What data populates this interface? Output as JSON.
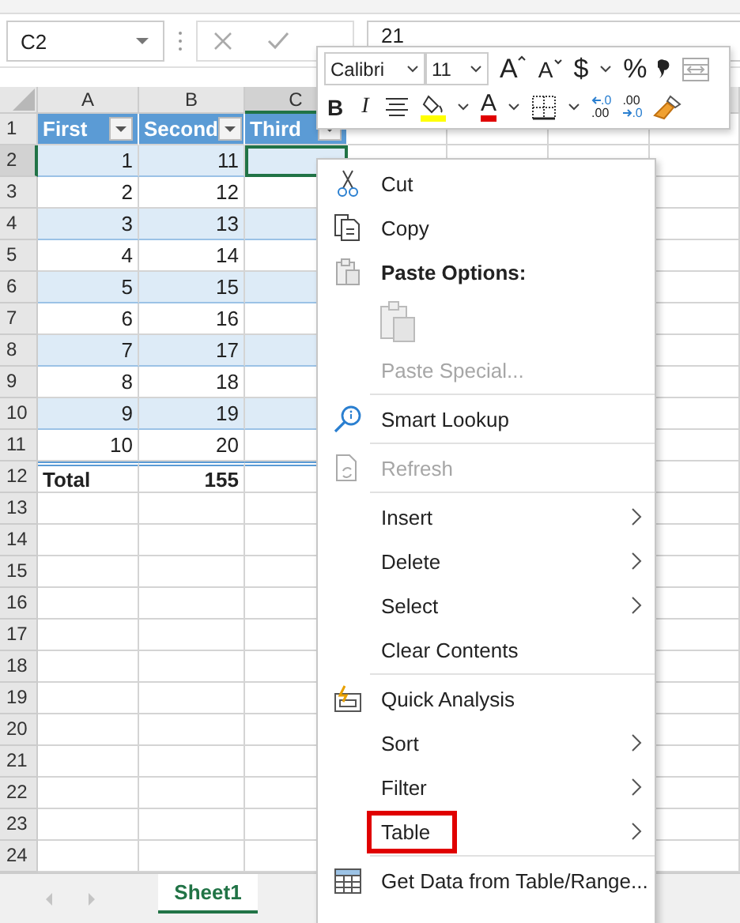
{
  "formula_bar": {
    "name_box": "C2",
    "formula": "21"
  },
  "mini_toolbar": {
    "font": "Calibri",
    "size": "11",
    "grow_font": "A",
    "shrink_font": "A",
    "currency": "$",
    "percent": "%",
    "bold": "B",
    "italic": "I",
    "font_color": "A",
    "increase_decimal": {
      "top": ".0",
      "bottom": ".00"
    },
    "decrease_decimal": {
      "top": ".00",
      "bottom": ".0"
    }
  },
  "grid": {
    "columns": [
      {
        "label": "A",
        "selected": false
      },
      {
        "label": "B",
        "selected": false
      },
      {
        "label": "C",
        "selected": true
      }
    ],
    "rows": [
      {
        "number": "1",
        "selected": false,
        "kind": "header",
        "cells": [
          "First",
          "Second",
          "Third"
        ]
      },
      {
        "number": "2",
        "selected": true,
        "kind": "data",
        "cells": [
          "1",
          "11",
          ""
        ]
      },
      {
        "number": "3",
        "selected": false,
        "kind": "data",
        "cells": [
          "2",
          "12",
          ""
        ]
      },
      {
        "number": "4",
        "selected": false,
        "kind": "data",
        "cells": [
          "3",
          "13",
          ""
        ]
      },
      {
        "number": "5",
        "selected": false,
        "kind": "data",
        "cells": [
          "4",
          "14",
          ""
        ]
      },
      {
        "number": "6",
        "selected": false,
        "kind": "data",
        "cells": [
          "5",
          "15",
          ""
        ]
      },
      {
        "number": "7",
        "selected": false,
        "kind": "data",
        "cells": [
          "6",
          "16",
          ""
        ]
      },
      {
        "number": "8",
        "selected": false,
        "kind": "data",
        "cells": [
          "7",
          "17",
          ""
        ]
      },
      {
        "number": "9",
        "selected": false,
        "kind": "data",
        "cells": [
          "8",
          "18",
          ""
        ]
      },
      {
        "number": "10",
        "selected": false,
        "kind": "data",
        "cells": [
          "9",
          "19",
          ""
        ]
      },
      {
        "number": "11",
        "selected": false,
        "kind": "data",
        "cells": [
          "10",
          "20",
          ""
        ]
      },
      {
        "number": "12",
        "selected": false,
        "kind": "total",
        "cells": [
          "Total",
          "155",
          ""
        ]
      },
      {
        "number": "13",
        "selected": false,
        "kind": "empty",
        "cells": [
          "",
          "",
          ""
        ]
      },
      {
        "number": "14",
        "selected": false,
        "kind": "empty",
        "cells": [
          "",
          "",
          ""
        ]
      },
      {
        "number": "15",
        "selected": false,
        "kind": "empty",
        "cells": [
          "",
          "",
          ""
        ]
      },
      {
        "number": "16",
        "selected": false,
        "kind": "empty",
        "cells": [
          "",
          "",
          ""
        ]
      },
      {
        "number": "17",
        "selected": false,
        "kind": "empty",
        "cells": [
          "",
          "",
          ""
        ]
      },
      {
        "number": "18",
        "selected": false,
        "kind": "empty",
        "cells": [
          "",
          "",
          ""
        ]
      },
      {
        "number": "19",
        "selected": false,
        "kind": "empty",
        "cells": [
          "",
          "",
          ""
        ]
      },
      {
        "number": "20",
        "selected": false,
        "kind": "empty",
        "cells": [
          "",
          "",
          ""
        ]
      },
      {
        "number": "21",
        "selected": false,
        "kind": "empty",
        "cells": [
          "",
          "",
          ""
        ]
      },
      {
        "number": "22",
        "selected": false,
        "kind": "empty",
        "cells": [
          "",
          "",
          ""
        ]
      },
      {
        "number": "23",
        "selected": false,
        "kind": "empty",
        "cells": [
          "",
          "",
          ""
        ]
      },
      {
        "number": "24",
        "selected": false,
        "kind": "empty",
        "cells": [
          "",
          "",
          ""
        ]
      }
    ]
  },
  "context_menu": {
    "items": [
      {
        "kind": "item",
        "label": "Cut",
        "disabled": false,
        "submenu": false,
        "highlighted": false
      },
      {
        "kind": "item",
        "label": "Copy",
        "disabled": false,
        "submenu": false,
        "highlighted": false
      },
      {
        "kind": "heading",
        "label": "Paste Options:"
      },
      {
        "kind": "paste-icons"
      },
      {
        "kind": "item",
        "label": "Paste Special...",
        "disabled": true,
        "submenu": false,
        "highlighted": false
      },
      {
        "kind": "separator"
      },
      {
        "kind": "item",
        "label": "Smart Lookup",
        "disabled": false,
        "submenu": false,
        "highlighted": false
      },
      {
        "kind": "separator"
      },
      {
        "kind": "item",
        "label": "Refresh",
        "disabled": true,
        "submenu": false,
        "highlighted": false
      },
      {
        "kind": "separator"
      },
      {
        "kind": "item",
        "label": "Insert",
        "disabled": false,
        "submenu": true,
        "highlighted": false
      },
      {
        "kind": "item",
        "label": "Delete",
        "disabled": false,
        "submenu": true,
        "highlighted": false
      },
      {
        "kind": "item",
        "label": "Select",
        "disabled": false,
        "submenu": true,
        "highlighted": false
      },
      {
        "kind": "item",
        "label": "Clear Contents",
        "disabled": false,
        "submenu": false,
        "highlighted": false
      },
      {
        "kind": "separator"
      },
      {
        "kind": "item",
        "label": "Quick Analysis",
        "disabled": false,
        "submenu": false,
        "highlighted": false
      },
      {
        "kind": "item",
        "label": "Sort",
        "disabled": false,
        "submenu": true,
        "highlighted": false
      },
      {
        "kind": "item",
        "label": "Filter",
        "disabled": false,
        "submenu": true,
        "highlighted": false
      },
      {
        "kind": "item",
        "label": "Table",
        "disabled": false,
        "submenu": true,
        "highlighted": true
      },
      {
        "kind": "separator"
      },
      {
        "kind": "item",
        "label": "Get Data from Table/Range...",
        "disabled": false,
        "submenu": false,
        "highlighted": false
      }
    ]
  },
  "sheet_tabs": [
    {
      "label": "Sheet1",
      "selected": true
    }
  ]
}
